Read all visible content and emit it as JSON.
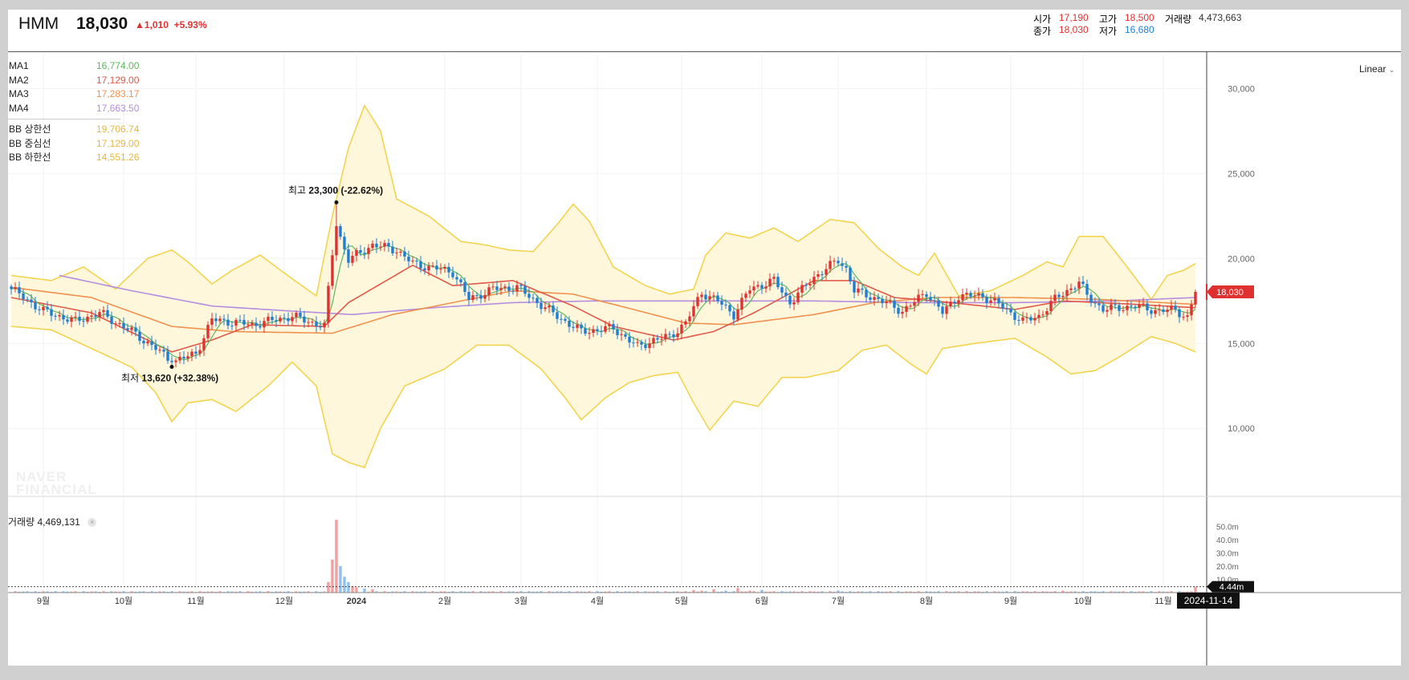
{
  "header": {
    "symbol": "HMM",
    "price": "18,030",
    "change": "▲1,010",
    "change_pct": "+5.93%",
    "open_label": "시가",
    "open": "17,190",
    "high_label": "고가",
    "high": "18,500",
    "volume_label": "거래량",
    "volume": "4,473,663",
    "close_label": "종가",
    "close": "18,030",
    "low_label": "저가",
    "low": "16,680"
  },
  "legend": {
    "ma": [
      {
        "name": "MA1",
        "value": "16,774.00",
        "color": "#5fb95f"
      },
      {
        "name": "MA2",
        "value": "17,129.00",
        "color": "#e05a4a"
      },
      {
        "name": "MA3",
        "value": "17,283.17",
        "color": "#f0924e"
      },
      {
        "name": "MA4",
        "value": "17,663.50",
        "color": "#b58de0"
      }
    ],
    "bb": [
      {
        "name": "BB 상한선",
        "value": "19,706.74",
        "color": "#e8b93e"
      },
      {
        "name": "BB 중심선",
        "value": "17,129.00",
        "color": "#e8b93e"
      },
      {
        "name": "BB 하한선",
        "value": "14,551.26",
        "color": "#e8b93e"
      }
    ]
  },
  "scale_mode": "Linear",
  "volume_panel": {
    "label": "거래량",
    "value": "4,469,131",
    "close_glyph": "×"
  },
  "watermark": [
    "NAVER",
    "FINANCIAL"
  ],
  "current_date": "2024-11-14",
  "colors": {
    "up": "#e03131",
    "down": "#1c7ed6",
    "band_fill": "#fff7dc",
    "band_line": "#f2d44e"
  },
  "chart_data": {
    "type": "candlestick",
    "price_ylim": [
      6000,
      32000
    ],
    "price_ticks": [
      {
        "value": 10000,
        "label": "10,000"
      },
      {
        "value": 15000,
        "label": "15,000"
      },
      {
        "value": 20000,
        "label": "20,000"
      },
      {
        "value": 25000,
        "label": "25,000"
      },
      {
        "value": 30000,
        "label": "30,000"
      }
    ],
    "volume_ylim": [
      0,
      60
    ],
    "volume_ticks": [
      {
        "value": 50,
        "label": "50.0m"
      },
      {
        "value": 40,
        "label": "40.0m"
      },
      {
        "value": 30,
        "label": "30.0m"
      },
      {
        "value": 20,
        "label": "20.0m"
      },
      {
        "value": 10,
        "label": "10.0m"
      }
    ],
    "x_ticks": [
      {
        "i": 8,
        "label": "9월"
      },
      {
        "i": 28,
        "label": "10월"
      },
      {
        "i": 46,
        "label": "11월"
      },
      {
        "i": 68,
        "label": "12월"
      },
      {
        "i": 86,
        "label": "2024"
      },
      {
        "i": 108,
        "label": "2월"
      },
      {
        "i": 127,
        "label": "3월"
      },
      {
        "i": 146,
        "label": "4월"
      },
      {
        "i": 167,
        "label": "5월"
      },
      {
        "i": 187,
        "label": "6월"
      },
      {
        "i": 206,
        "label": "7월"
      },
      {
        "i": 228,
        "label": "8월"
      },
      {
        "i": 249,
        "label": "9월"
      },
      {
        "i": 267,
        "label": "10월"
      },
      {
        "i": 287,
        "label": "11월"
      }
    ],
    "last_price_label": "18,030",
    "last_price": 18030,
    "last_volume_label": "4.44m",
    "last_volume": 4.44,
    "high_annotation": {
      "i": 81,
      "value": 23300,
      "prefix": "최고",
      "text": "23,300 (-22.62%)"
    },
    "low_annotation": {
      "i": 40,
      "value": 13620,
      "prefix": "최저",
      "text": "13,620 (+32.38%)"
    },
    "close_anchors": [
      [
        0,
        18200
      ],
      [
        8,
        16900
      ],
      [
        16,
        16300
      ],
      [
        22,
        16800
      ],
      [
        30,
        15700
      ],
      [
        36,
        14700
      ],
      [
        40,
        13900
      ],
      [
        46,
        14400
      ],
      [
        50,
        16400
      ],
      [
        60,
        16100
      ],
      [
        70,
        16600
      ],
      [
        78,
        16000
      ],
      [
        80,
        20300
      ],
      [
        81,
        21900
      ],
      [
        84,
        19900
      ],
      [
        90,
        20800
      ],
      [
        96,
        20500
      ],
      [
        100,
        19700
      ],
      [
        110,
        19200
      ],
      [
        114,
        17600
      ],
      [
        120,
        18200
      ],
      [
        126,
        18300
      ],
      [
        130,
        17600
      ],
      [
        136,
        16600
      ],
      [
        142,
        15700
      ],
      [
        150,
        15900
      ],
      [
        156,
        14800
      ],
      [
        160,
        15200
      ],
      [
        164,
        15400
      ],
      [
        168,
        16200
      ],
      [
        172,
        18000
      ],
      [
        176,
        17500
      ],
      [
        180,
        16700
      ],
      [
        184,
        18200
      ],
      [
        190,
        18700
      ],
      [
        194,
        17400
      ],
      [
        200,
        18900
      ],
      [
        206,
        19900
      ],
      [
        208,
        19400
      ],
      [
        210,
        18100
      ],
      [
        216,
        17600
      ],
      [
        222,
        16900
      ],
      [
        228,
        18000
      ],
      [
        232,
        16800
      ],
      [
        236,
        17800
      ],
      [
        242,
        17800
      ],
      [
        246,
        17300
      ],
      [
        252,
        16300
      ],
      [
        256,
        16600
      ],
      [
        260,
        17600
      ],
      [
        266,
        18600
      ],
      [
        268,
        17800
      ],
      [
        272,
        17000
      ],
      [
        280,
        17200
      ],
      [
        286,
        16900
      ],
      [
        290,
        17000
      ],
      [
        293,
        16500
      ],
      [
        295,
        18030
      ]
    ],
    "ma_anchors": {
      "MA2": [
        [
          0,
          17700
        ],
        [
          20,
          16800
        ],
        [
          40,
          14500
        ],
        [
          50,
          15200
        ],
        [
          60,
          16100
        ],
        [
          78,
          16000
        ],
        [
          84,
          17400
        ],
        [
          100,
          19600
        ],
        [
          110,
          18400
        ],
        [
          125,
          18700
        ],
        [
          140,
          17200
        ],
        [
          150,
          16000
        ],
        [
          165,
          15200
        ],
        [
          175,
          15700
        ],
        [
          185,
          16800
        ],
        [
          200,
          18700
        ],
        [
          210,
          18700
        ],
        [
          220,
          17700
        ],
        [
          230,
          17500
        ],
        [
          250,
          17000
        ],
        [
          262,
          17500
        ],
        [
          280,
          17300
        ],
        [
          295,
          17100
        ]
      ],
      "MA3": [
        [
          0,
          18300
        ],
        [
          20,
          17700
        ],
        [
          40,
          16000
        ],
        [
          55,
          15700
        ],
        [
          80,
          15600
        ],
        [
          95,
          16700
        ],
        [
          110,
          17400
        ],
        [
          125,
          18100
        ],
        [
          140,
          17900
        ],
        [
          155,
          17000
        ],
        [
          168,
          16200
        ],
        [
          180,
          16100
        ],
        [
          200,
          16700
        ],
        [
          215,
          17400
        ],
        [
          230,
          17700
        ],
        [
          250,
          17700
        ],
        [
          270,
          17600
        ],
        [
          295,
          17300
        ]
      ],
      "MA4": [
        [
          12,
          19000
        ],
        [
          30,
          18100
        ],
        [
          50,
          17200
        ],
        [
          70,
          16900
        ],
        [
          85,
          16700
        ],
        [
          105,
          17100
        ],
        [
          125,
          17400
        ],
        [
          145,
          17500
        ],
        [
          170,
          17500
        ],
        [
          200,
          17500
        ],
        [
          225,
          17400
        ],
        [
          250,
          17400
        ],
        [
          275,
          17500
        ],
        [
          295,
          17700
        ]
      ]
    },
    "bb_anchors": {
      "upper": [
        [
          0,
          19000
        ],
        [
          10,
          18700
        ],
        [
          18,
          19500
        ],
        [
          26,
          18200
        ],
        [
          34,
          20000
        ],
        [
          40,
          20500
        ],
        [
          44,
          19800
        ],
        [
          50,
          18500
        ],
        [
          55,
          19300
        ],
        [
          62,
          20200
        ],
        [
          70,
          18800
        ],
        [
          76,
          17800
        ],
        [
          80,
          22500
        ],
        [
          84,
          26500
        ],
        [
          88,
          29000
        ],
        [
          92,
          27500
        ],
        [
          96,
          23500
        ],
        [
          104,
          22500
        ],
        [
          112,
          21000
        ],
        [
          118,
          20800
        ],
        [
          124,
          20500
        ],
        [
          130,
          20400
        ],
        [
          136,
          22000
        ],
        [
          140,
          23200
        ],
        [
          144,
          22200
        ],
        [
          150,
          19500
        ],
        [
          158,
          18400
        ],
        [
          164,
          17900
        ],
        [
          170,
          18200
        ],
        [
          173,
          20200
        ],
        [
          178,
          21500
        ],
        [
          184,
          21200
        ],
        [
          190,
          21800
        ],
        [
          196,
          21000
        ],
        [
          204,
          22300
        ],
        [
          210,
          22100
        ],
        [
          216,
          20600
        ],
        [
          222,
          19500
        ],
        [
          226,
          19000
        ],
        [
          230,
          20300
        ],
        [
          236,
          17800
        ],
        [
          244,
          18100
        ],
        [
          252,
          19000
        ],
        [
          258,
          19800
        ],
        [
          262,
          19500
        ],
        [
          266,
          21300
        ],
        [
          272,
          21300
        ],
        [
          278,
          19500
        ],
        [
          284,
          17600
        ],
        [
          288,
          19000
        ],
        [
          292,
          19300
        ],
        [
          295,
          19700
        ]
      ],
      "lower": [
        [
          0,
          16000
        ],
        [
          10,
          15800
        ],
        [
          20,
          14700
        ],
        [
          30,
          13600
        ],
        [
          36,
          12100
        ],
        [
          40,
          10400
        ],
        [
          44,
          11500
        ],
        [
          50,
          11700
        ],
        [
          56,
          11000
        ],
        [
          64,
          12500
        ],
        [
          70,
          13900
        ],
        [
          76,
          12500
        ],
        [
          80,
          8500
        ],
        [
          84,
          8000
        ],
        [
          88,
          7700
        ],
        [
          92,
          10000
        ],
        [
          98,
          12500
        ],
        [
          108,
          13500
        ],
        [
          116,
          14900
        ],
        [
          124,
          14900
        ],
        [
          132,
          13500
        ],
        [
          138,
          11800
        ],
        [
          142,
          10500
        ],
        [
          148,
          11800
        ],
        [
          154,
          12700
        ],
        [
          160,
          13100
        ],
        [
          166,
          13300
        ],
        [
          170,
          11500
        ],
        [
          174,
          9900
        ],
        [
          180,
          11600
        ],
        [
          186,
          11300
        ],
        [
          192,
          13000
        ],
        [
          198,
          13000
        ],
        [
          206,
          13400
        ],
        [
          212,
          14600
        ],
        [
          218,
          14900
        ],
        [
          224,
          13800
        ],
        [
          228,
          13200
        ],
        [
          232,
          14700
        ],
        [
          240,
          15000
        ],
        [
          250,
          15300
        ],
        [
          258,
          14200
        ],
        [
          264,
          13200
        ],
        [
          270,
          13400
        ],
        [
          276,
          14200
        ],
        [
          284,
          15400
        ],
        [
          290,
          15000
        ],
        [
          295,
          14500
        ]
      ]
    },
    "volume_spikes": [
      [
        79,
        8
      ],
      [
        80,
        25
      ],
      [
        81,
        55
      ],
      [
        82,
        20
      ],
      [
        83,
        12
      ],
      [
        84,
        8
      ],
      [
        85,
        5
      ],
      [
        86,
        4
      ],
      [
        88,
        3
      ],
      [
        90,
        2.5
      ],
      [
        170,
        2
      ],
      [
        172,
        1.5
      ],
      [
        175,
        2.5
      ],
      [
        178,
        1.5
      ],
      [
        181,
        3.5
      ],
      [
        184,
        1.5
      ],
      [
        187,
        2
      ],
      [
        206,
        1.5
      ],
      [
        262,
        1.5
      ],
      [
        295,
        4.44
      ]
    ]
  }
}
